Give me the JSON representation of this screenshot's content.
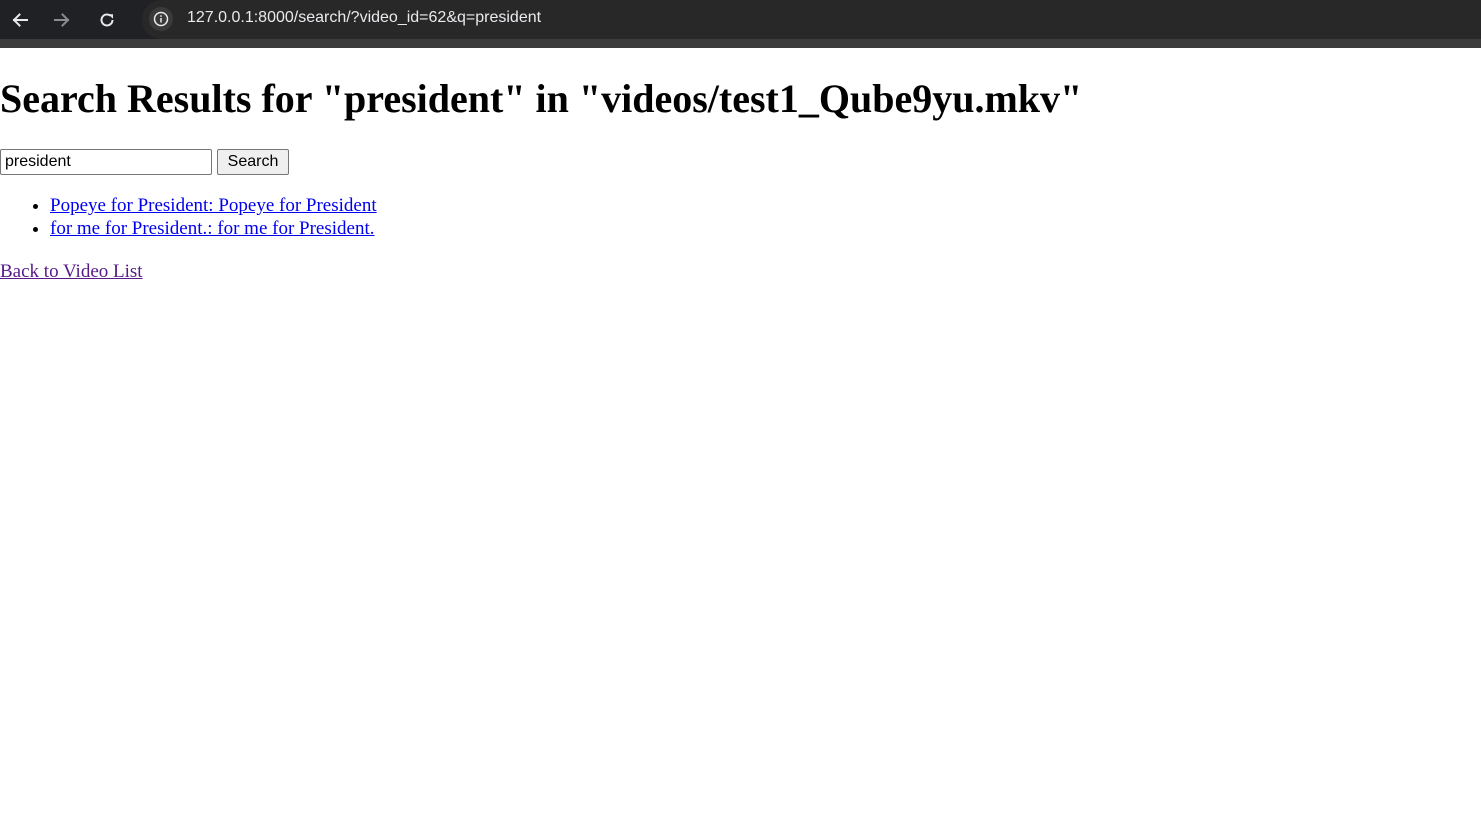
{
  "browser": {
    "url": "127.0.0.1:8000/search/?video_id=62&q=president",
    "back_icon": "arrow-left-icon",
    "forward_icon": "arrow-right-icon",
    "reload_icon": "reload-icon",
    "info_icon": "info-icon"
  },
  "page": {
    "title": "Search Results for \"president\" in \"videos/test1_Qube9yu.mkv\"",
    "search": {
      "value": "president",
      "button_label": "Search"
    },
    "results": [
      "Popeye for President: Popeye for President",
      "for me for President.: for me for President."
    ],
    "back_link": "Back to Video List"
  },
  "colors": {
    "link": "#0000ee",
    "visited_link": "#551a8b",
    "browser_bar": "#202124"
  }
}
